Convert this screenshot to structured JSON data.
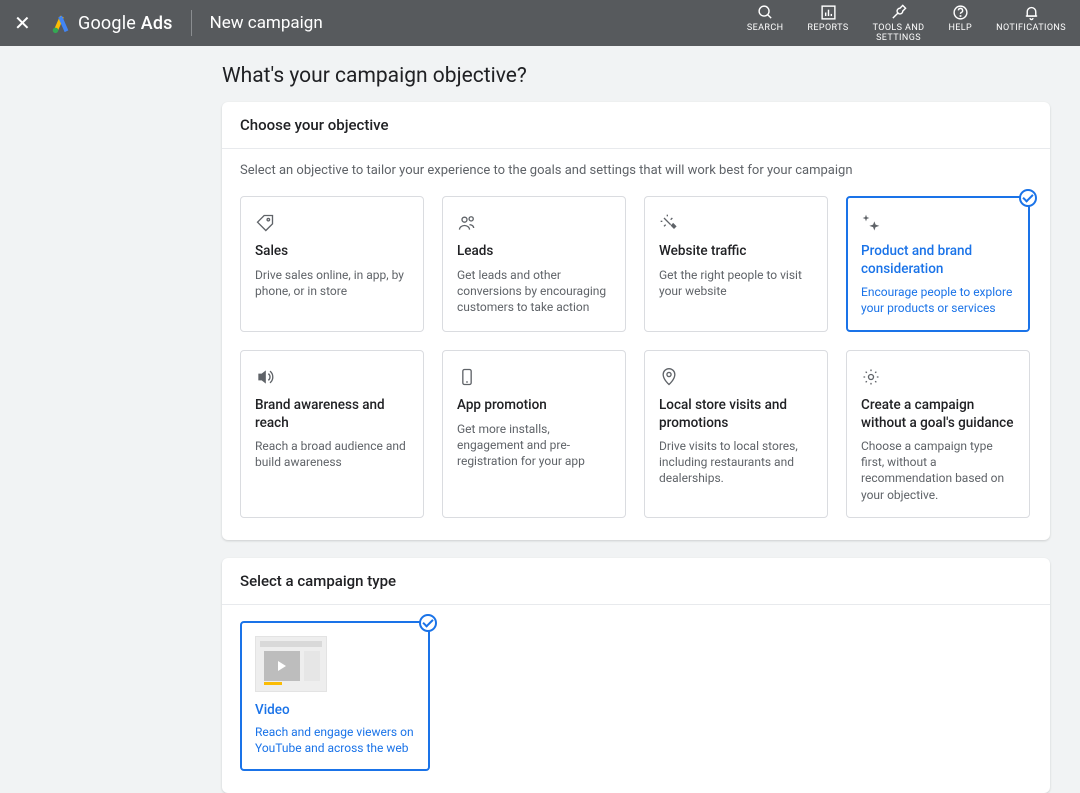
{
  "header": {
    "product": "Google",
    "product_suffix": "Ads",
    "page_title": "New campaign",
    "nav": [
      {
        "label": "SEARCH"
      },
      {
        "label": "REPORTS"
      },
      {
        "label": "TOOLS AND\nSETTINGS"
      },
      {
        "label": "HELP"
      },
      {
        "label": "NOTIFICATIONS"
      }
    ]
  },
  "main": {
    "heading": "What's your campaign objective?",
    "objective_card": {
      "title": "Choose your objective",
      "subtitle": "Select an objective to tailor your experience to the goals and settings that will work best for your campaign",
      "options": [
        {
          "title": "Sales",
          "desc": "Drive sales online, in app, by phone, or in store",
          "selected": false
        },
        {
          "title": "Leads",
          "desc": "Get leads and other conversions by encouraging customers to take action",
          "selected": false
        },
        {
          "title": "Website traffic",
          "desc": "Get the right people to visit your website",
          "selected": false
        },
        {
          "title": "Product and brand consideration",
          "desc": "Encourage people to explore your products or services",
          "selected": true
        },
        {
          "title": "Brand awareness and reach",
          "desc": "Reach a broad audience and build awareness",
          "selected": false
        },
        {
          "title": "App promotion",
          "desc": "Get more installs, engagement and pre-registration for your app",
          "selected": false
        },
        {
          "title": "Local store visits and promotions",
          "desc": "Drive visits to local stores, including restaurants and dealerships.",
          "selected": false
        },
        {
          "title": "Create a campaign without a goal's guidance",
          "desc": "Choose a campaign type first, without a recommendation based on your objective.",
          "selected": false
        }
      ]
    },
    "campaign_type_card": {
      "title": "Select a campaign type",
      "options": [
        {
          "title": "Video",
          "desc": "Reach and engage viewers on YouTube and across the web",
          "selected": true
        }
      ]
    }
  }
}
